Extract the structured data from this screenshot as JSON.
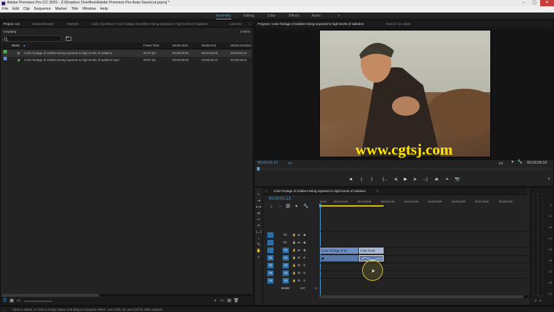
{
  "window": {
    "title": "Adobe Premiere Pro CC 2015 - Z:\\Dropbox Overflow\\Adobe Premiere Pro Auto-Save\\cut.prproj *",
    "controls": [
      "–",
      "▢",
      "✕"
    ]
  },
  "menu": [
    "File",
    "Edit",
    "Clip",
    "Sequence",
    "Marker",
    "Title",
    "Window",
    "Help"
  ],
  "workspaces": {
    "items": [
      "Assembly",
      "Editing",
      "Color",
      "Effects",
      "Audio"
    ],
    "active": "Assembly",
    "more": "»"
  },
  "project_panel": {
    "tabs": [
      "Project: cut",
      "Media Browser",
      "Markers",
      "Audio Clip Mixer: Color footage of soldiers being exposed to high levels of radiation",
      "Libraries"
    ],
    "more": "»",
    "project_file": "cut.prproj",
    "item_count": "2 Items",
    "columns": [
      "Name",
      "Frame Rate",
      "Media Start",
      "Media End",
      "Media Duration"
    ],
    "items": [
      {
        "name": "Color footage of soldiers being exposed to high levels of radiation",
        "frame_rate": "29.97 fps",
        "media_start": "00;00;00;00",
        "media_end": "00;02;56;09",
        "duration": "00;02;56;10",
        "color": "#4caf50"
      },
      {
        "name": "Color footage of soldiers being exposed to high levels of radiation.mp4",
        "frame_rate": "29.97 fps",
        "media_start": "00;00;00;00",
        "media_end": "00;08;35;22",
        "duration": "00;08;35;23",
        "color": "#5b8fd6"
      }
    ]
  },
  "program_monitor": {
    "tab": "Program: Color footage of soldiers being exposed to high levels of radiation",
    "source_tab": "Source: (no clips)",
    "timecode": "00;00;01;13",
    "fit": "Fit",
    "resolution": "1/2",
    "duration": "00;02;56;10",
    "watermark": "www.cgtsj.com"
  },
  "timeline": {
    "tab": "Color footage of soldiers being exposed to high levels of radiation",
    "timecode": "00;00;01;13",
    "ruler": [
      "00;00",
      "00;01;04;00",
      "00;02;08;00",
      "00;03;12;00",
      "00;04;16;00",
      "00;05;20;00",
      "00;06;24;00",
      "00;07;28;00",
      "00;08;32;00"
    ],
    "video_tracks": [
      "V3",
      "V2",
      "V1"
    ],
    "audio_tracks": [
      "A1",
      "A2",
      "A3",
      "A4"
    ],
    "master": "Master",
    "master_value": "0.0",
    "clips": {
      "v1_a": "Color footage of so",
      "v1_b": "Color foota"
    },
    "meter_scale": [
      "-6",
      "-12",
      "-18",
      "-24",
      "-30",
      "-36",
      "-42",
      "-48",
      "-54"
    ],
    "meter_bottom": [
      "S",
      "S"
    ]
  },
  "status_bar": "Click to select, or click in empty space and drag to marquee select. Use Shift, Alt, and Ctrl for other options."
}
